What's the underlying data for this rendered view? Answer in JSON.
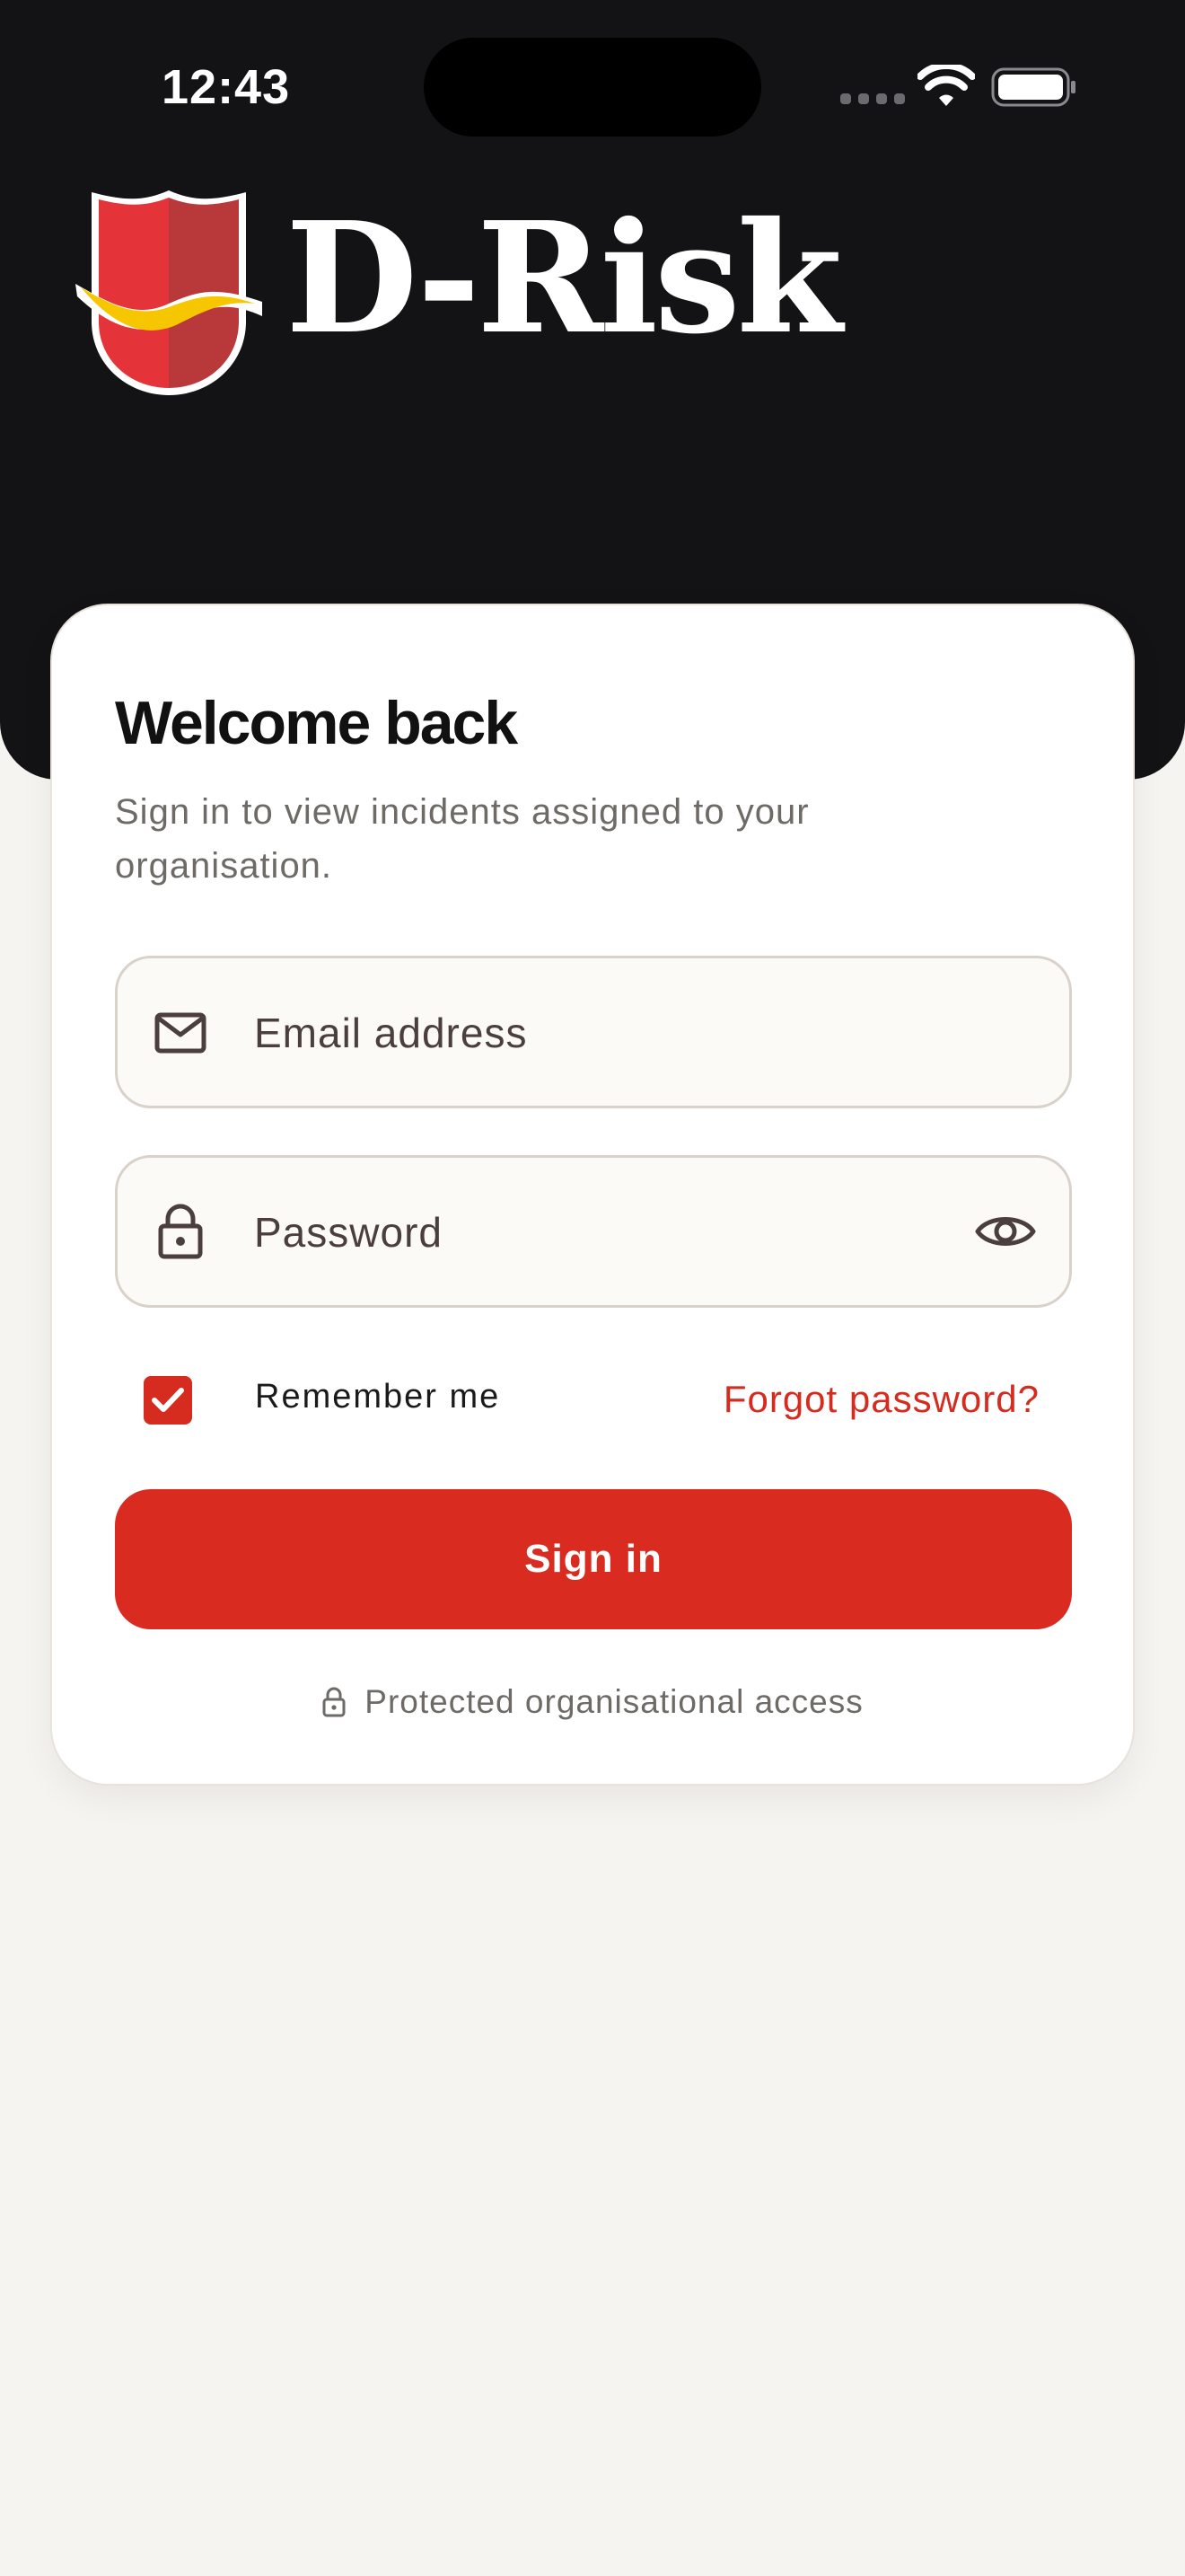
{
  "status_bar": {
    "time": "12:43"
  },
  "brand": {
    "name": "D-Risk",
    "colors": {
      "shield_left": "#e5333a",
      "shield_right": "#b9393b",
      "ribbon": "#f6c600"
    }
  },
  "login": {
    "title": "Welcome back",
    "subtitle": "Sign in to view incidents assigned to your organisation.",
    "email_placeholder": "Email address",
    "email_value": "",
    "password_placeholder": "Password",
    "password_value": "",
    "remember_label": "Remember me",
    "remember_checked": true,
    "forgot_label": "Forgot password?",
    "signin_label": "Sign in",
    "protected_note": "Protected organisational access"
  },
  "icons": {
    "email": "mail-icon",
    "password": "lock-icon",
    "reveal": "eye-icon",
    "note": "lock-icon"
  },
  "theme": {
    "accent": "#d92b1f",
    "header_bg": "#131316",
    "page_bg": "#f6f4f0"
  }
}
